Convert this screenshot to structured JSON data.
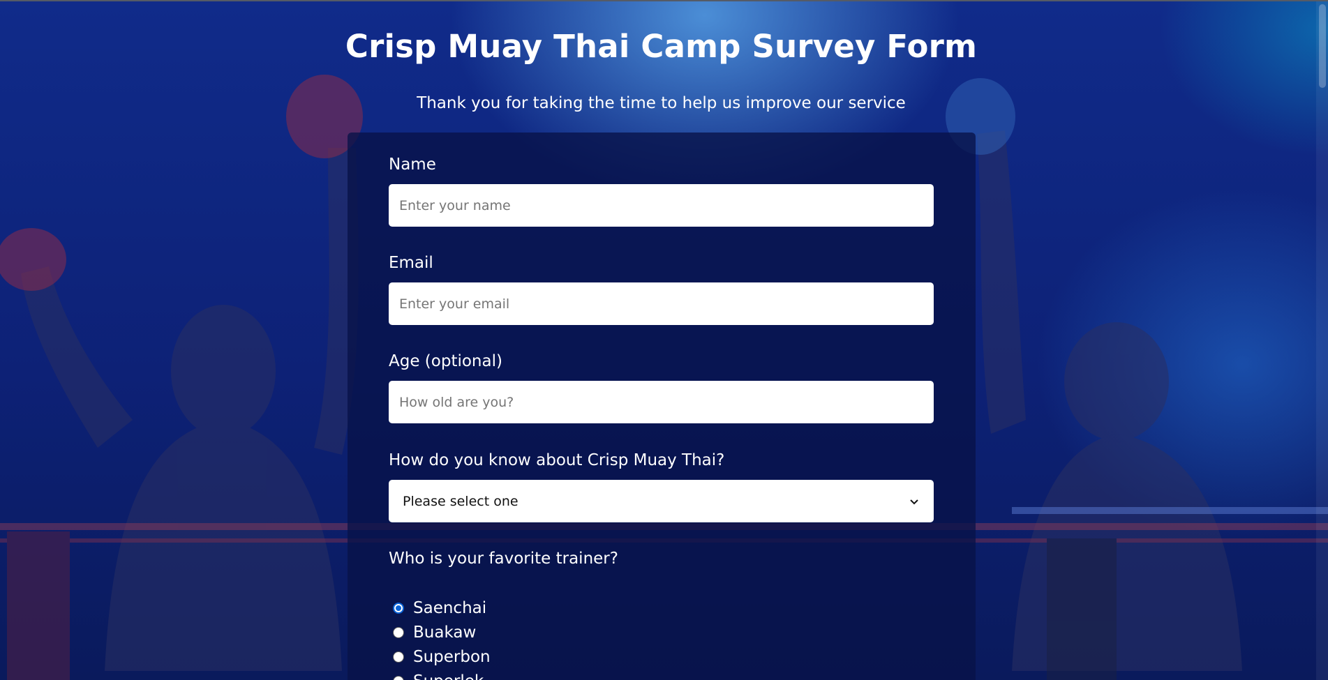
{
  "header": {
    "title": "Crisp Muay Thai Camp Survey Form",
    "description": "Thank you for taking the time to help us improve our service"
  },
  "form": {
    "name": {
      "label": "Name",
      "placeholder": "Enter your name",
      "value": ""
    },
    "email": {
      "label": "Email",
      "placeholder": "Enter your email",
      "value": ""
    },
    "age": {
      "label": "Age (optional)",
      "placeholder": "How old are you?",
      "value": ""
    },
    "referral": {
      "label": "How do you know about Crisp Muay Thai?",
      "selected": "Please select one"
    },
    "trainer": {
      "label": "Who is your favorite trainer?",
      "options": [
        {
          "label": "Saenchai",
          "checked": true
        },
        {
          "label": "Buakaw",
          "checked": false
        },
        {
          "label": "Superbon",
          "checked": false
        },
        {
          "label": "Superlek",
          "checked": false
        }
      ]
    }
  },
  "theme": {
    "accent": "#0a63d8",
    "panel": "#081248",
    "background": "#0d2176"
  }
}
